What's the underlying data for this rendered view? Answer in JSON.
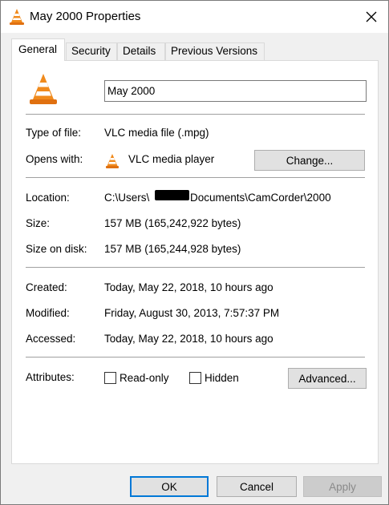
{
  "window": {
    "title": "May 2000 Properties",
    "close_glyph": "✕"
  },
  "tabs": [
    {
      "label": "General",
      "active": true
    },
    {
      "label": "Security",
      "active": false
    },
    {
      "label": "Details",
      "active": false
    },
    {
      "label": "Previous Versions",
      "active": false
    }
  ],
  "general": {
    "file_name": "May 2000",
    "type_label": "Type of file:",
    "type_value": "VLC media file (.mpg)",
    "opens_label": "Opens with:",
    "opens_value": "VLC media player",
    "change_button": "Change...",
    "location_label": "Location:",
    "location_prefix": "C:\\Users\\",
    "location_suffix": "Documents\\CamCorder\\2000",
    "size_label": "Size:",
    "size_value": "157 MB (165,242,922 bytes)",
    "size_disk_label": "Size on disk:",
    "size_disk_value": "157 MB (165,244,928 bytes)",
    "created_label": "Created:",
    "created_value": "Today, May 22, 2018, 10 hours ago",
    "modified_label": "Modified:",
    "modified_value": "Friday, August 30, 2013, 7:57:37 PM",
    "accessed_label": "Accessed:",
    "accessed_value": "Today, May 22, 2018, 10 hours ago",
    "attributes_label": "Attributes:",
    "readonly_label": "Read-only",
    "readonly_checked": false,
    "hidden_label": "Hidden",
    "hidden_checked": false,
    "advanced_button": "Advanced..."
  },
  "footer": {
    "ok": "OK",
    "cancel": "Cancel",
    "apply": "Apply"
  },
  "icons": {
    "file_icon": "vlc-cone-icon",
    "app_icon": "vlc-cone-icon",
    "close": "close-icon"
  },
  "colors": {
    "accent": "#0078d7",
    "cone_orange": "#f08a1c",
    "button_face": "#e1e1e1",
    "disabled_text": "#8a8a8a"
  }
}
